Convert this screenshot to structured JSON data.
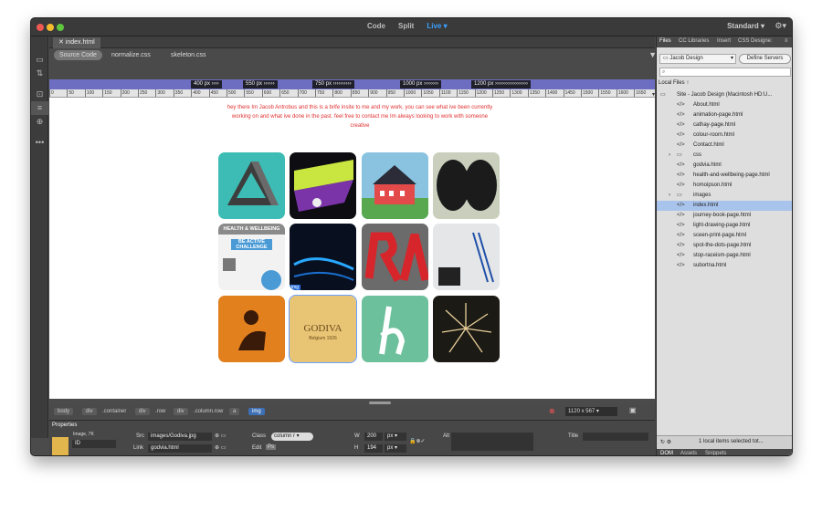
{
  "titlebar": {
    "modes": [
      "Code",
      "Split",
      "Live"
    ],
    "active_mode": "Live",
    "workspace": "Standard"
  },
  "doc_tab": "index.html",
  "src_bar": {
    "items": [
      "Source Code",
      "normalize.css",
      "skeleton.css"
    ]
  },
  "media_queries": [
    "400  px",
    "550  px",
    "750  px",
    "1000  px",
    "1200  px"
  ],
  "ruler_ticks": [
    "0",
    "50",
    "100",
    "150",
    "200",
    "250",
    "300",
    "350",
    "400",
    "450",
    "500",
    "550",
    "600",
    "650",
    "700",
    "750",
    "800",
    "850",
    "900",
    "950",
    "1000",
    "1050",
    "1100",
    "1150",
    "1200",
    "1250",
    "1300",
    "1350",
    "1400",
    "1450",
    "1500",
    "1550",
    "1600",
    "1650"
  ],
  "intro_text": "hey there Im Jacob Antrobus and this is a brife insite to me and my work, you can see what ive been currently working on and what ive done in the past. feel free to contact me Im always looking to work with someone creative",
  "tiles": {
    "health_caption": "HEALTH & WELLBEING",
    "health_sub": "BE ACTIVE CHALLENGE",
    "godiva_text": "GODIVA",
    "godiva_sub": "Belgium 1926",
    "img_tag": "img"
  },
  "tag_selector": {
    "tags": [
      "body",
      "div",
      ".container",
      "div",
      ".row",
      "div",
      ".column.row",
      "a",
      "img"
    ],
    "size": "1120 x 567"
  },
  "properties": {
    "title": "Properties",
    "image_label": "Image, 7K",
    "id_label": "ID",
    "src_label": "Src",
    "src_value": "images/Godiva.jpg",
    "link_label": "Link",
    "link_value": "godvia.html",
    "class_label": "Class",
    "class_value": "column r",
    "edit_label": "Edit",
    "w_label": "W",
    "w_value": "200",
    "h_label": "H",
    "h_value": "194",
    "unit": "px",
    "alt_label": "Alt",
    "title_label": "Title"
  },
  "right_panel": {
    "tabs": [
      "Files",
      "CC Libraries",
      "Insert",
      "CSS Designe:"
    ],
    "site_select": "Jacob Design",
    "define_servers": "Define Servers",
    "local_files": "Local Files",
    "files": [
      {
        "name": "Site - Jacob Design (Macintosh HD:U...",
        "type": "site",
        "indent": 0
      },
      {
        "name": "About.html",
        "type": "html",
        "indent": 1
      },
      {
        "name": "animation-page.html",
        "type": "html",
        "indent": 1
      },
      {
        "name": "cathay-page.html",
        "type": "html",
        "indent": 1
      },
      {
        "name": "colour-room.html",
        "type": "html",
        "indent": 1
      },
      {
        "name": "Contact.html",
        "type": "html",
        "indent": 1
      },
      {
        "name": "css",
        "type": "folder",
        "indent": 1
      },
      {
        "name": "godvia.html",
        "type": "html",
        "indent": 1
      },
      {
        "name": "health-and-wellbeing-page.html",
        "type": "html",
        "indent": 1
      },
      {
        "name": "homoipson.html",
        "type": "html",
        "indent": 1
      },
      {
        "name": "images",
        "type": "folder",
        "indent": 1
      },
      {
        "name": "index.html",
        "type": "html",
        "indent": 1,
        "selected": true
      },
      {
        "name": "journey-book-page.html",
        "type": "html",
        "indent": 1
      },
      {
        "name": "light-drawing-page.html",
        "type": "html",
        "indent": 1
      },
      {
        "name": "sceen-print-page.html",
        "type": "html",
        "indent": 1
      },
      {
        "name": "spot-the-dots-page.html",
        "type": "html",
        "indent": 1
      },
      {
        "name": "stop-raceism-page.html",
        "type": "html",
        "indent": 1
      },
      {
        "name": "subortna.html",
        "type": "html",
        "indent": 1
      }
    ],
    "status": "1 local items selected tot...",
    "bottom_tabs": [
      "DOM",
      "Assets",
      "Snippets"
    ]
  }
}
